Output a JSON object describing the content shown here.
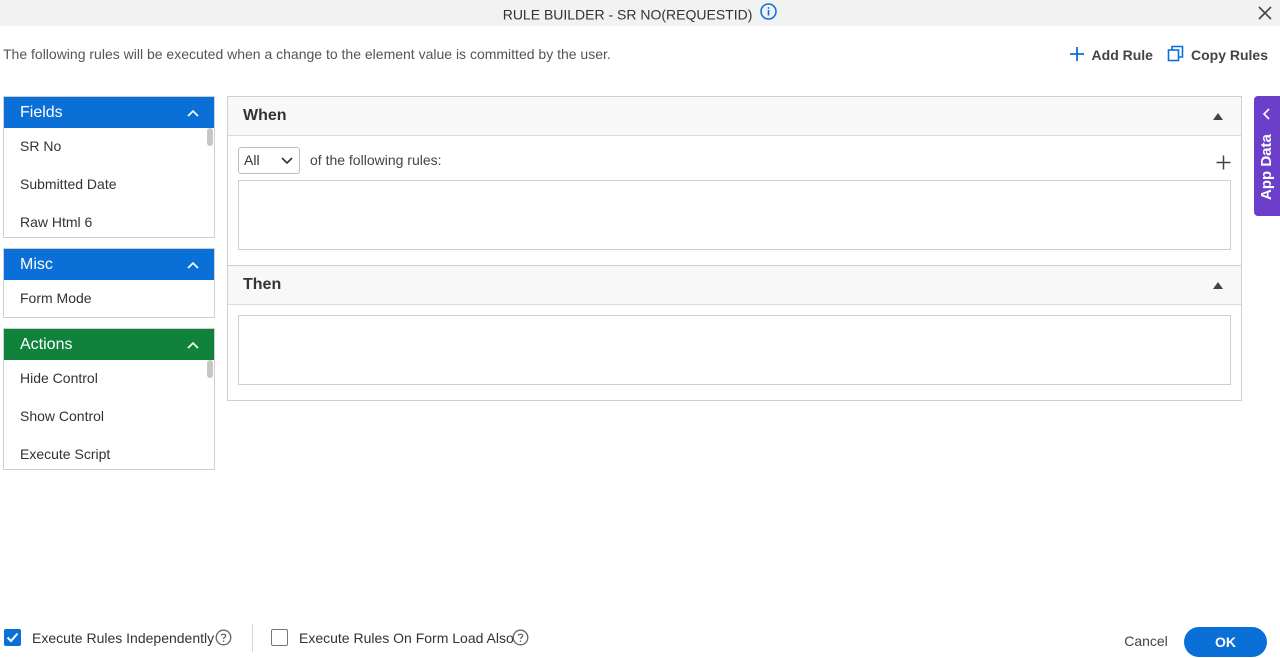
{
  "header": {
    "title": "RULE BUILDER - SR NO(REQUESTID)"
  },
  "description": "The following rules will be executed when a change to the element value is committed by the user.",
  "top_actions": {
    "add_rule": "Add Rule",
    "copy_rules": "Copy Rules"
  },
  "panels": {
    "fields": {
      "title": "Fields",
      "items": [
        "SR No",
        "Submitted Date",
        "Raw Html 6"
      ]
    },
    "misc": {
      "title": "Misc",
      "items": [
        "Form Mode"
      ]
    },
    "actions": {
      "title": "Actions",
      "items": [
        "Hide Control",
        "Show Control",
        "Execute Script"
      ]
    }
  },
  "when": {
    "title": "When",
    "match_select": "All",
    "match_text": "of the following rules:"
  },
  "then": {
    "title": "Then"
  },
  "app_data": {
    "label": "App Data"
  },
  "footer": {
    "execute_independently": {
      "label": "Execute Rules Independently",
      "checked": true
    },
    "execute_on_load": {
      "label": "Execute Rules On Form Load Also",
      "checked": false
    },
    "cancel": "Cancel",
    "ok": "OK"
  },
  "colors": {
    "primary": "#0a6fd6",
    "actions_green": "#11823b",
    "app_data_purple": "#6b3fc9"
  },
  "icons": [
    "info-icon",
    "close-icon",
    "plus-icon",
    "copy-icon",
    "chevron-up-icon",
    "chevron-down-icon",
    "chevron-left-icon",
    "triangle-up-icon",
    "checkmark-icon",
    "help-icon"
  ]
}
